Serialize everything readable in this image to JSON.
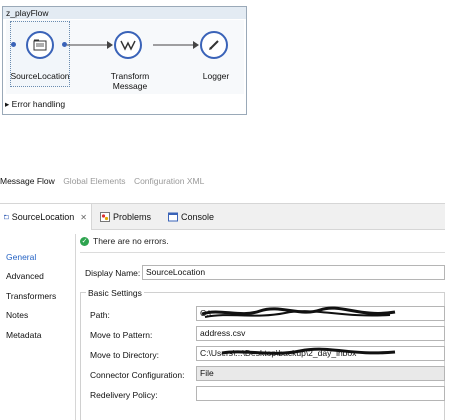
{
  "flow": {
    "title": "z_playFlow",
    "nodes": [
      {
        "label": "SourceLocation",
        "icon": "file-folder-icon"
      },
      {
        "label": "Transform\nMessage",
        "icon": "dataweave-transform-icon"
      },
      {
        "label": "Logger",
        "icon": "pencil-icon"
      }
    ],
    "transform_label_1": "Transform",
    "transform_label_2": "Message",
    "error_handling": "Error handling"
  },
  "editor_tabs": {
    "message_flow": "Message Flow",
    "global_elements": "Global Elements",
    "configuration_xml": "Configuration XML"
  },
  "properties": {
    "tabs": {
      "source": "SourceLocation",
      "problems": "Problems",
      "console": "Console"
    },
    "side_nav": {
      "general": "General",
      "advanced": "Advanced",
      "transformers": "Transformers",
      "notes": "Notes",
      "metadata": "Metadata"
    },
    "status": "There are no errors.",
    "display_name_label": "Display Name:",
    "display_name_value": "SourceLocation",
    "basic_settings": "Basic Settings",
    "fields": {
      "path_label": "Path:",
      "path_value": "C:\\",
      "move_to_pattern_label": "Move to Pattern:",
      "move_to_pattern_value": "address.csv",
      "move_to_directory_label": "Move to Directory:",
      "move_to_directory_value": "C:\\Users\\...\\Desktop\\backup\\2_day_inbox",
      "connector_configuration_label": "Connector Configuration:",
      "connector_configuration_value": "File",
      "redelivery_policy_label": "Redelivery Policy:"
    }
  },
  "colors": {
    "accent": "#3a63b8",
    "active_nav": "#2563c4",
    "ok": "#2ea44f",
    "title_bar": "#e3ebf3"
  }
}
